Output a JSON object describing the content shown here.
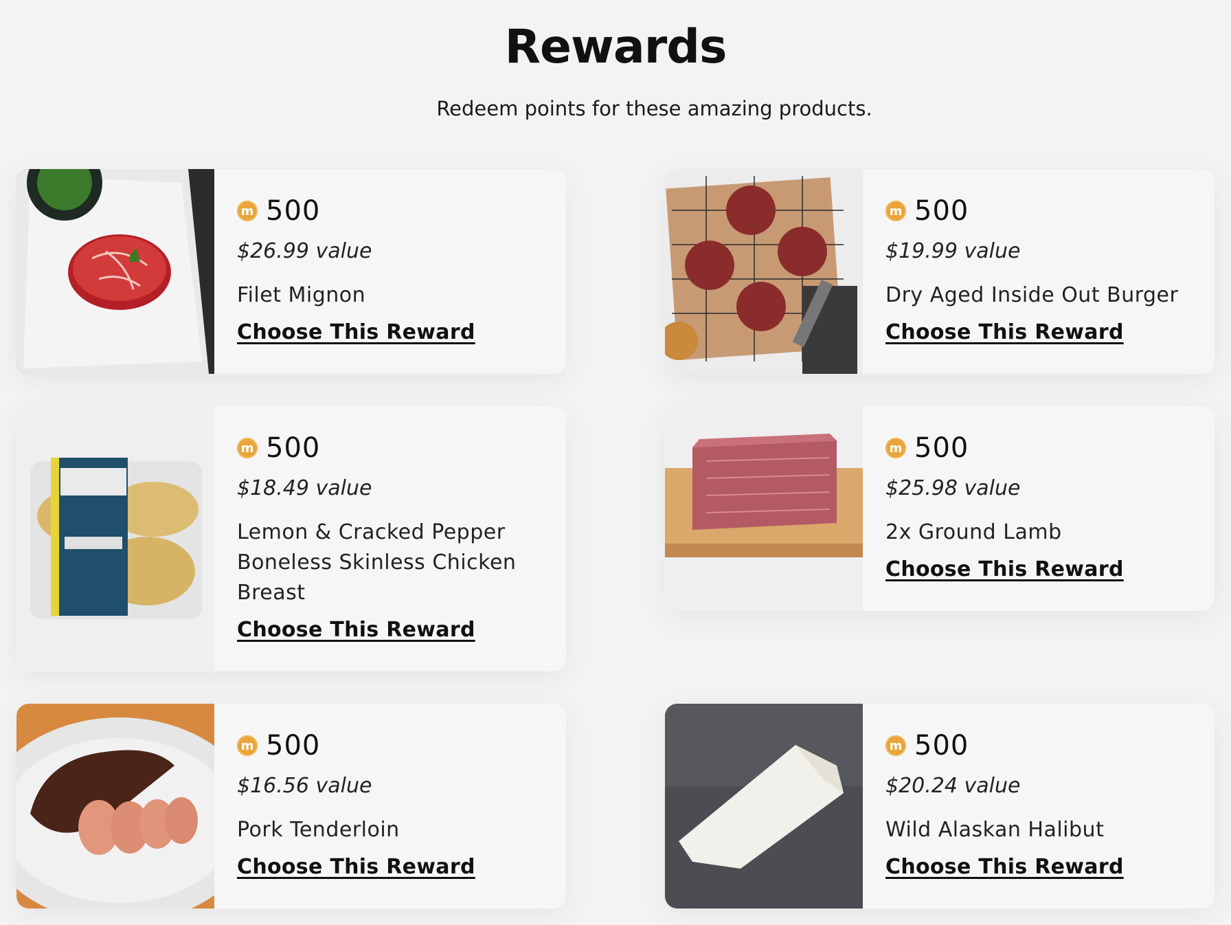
{
  "header": {
    "title": "Rewards",
    "subtitle": "Redeem points for these amazing products."
  },
  "coin_icon": "coin-icon",
  "coin_letter": "m",
  "accent_color": "#e9a53a",
  "rewards": [
    {
      "points": "500",
      "value": "$26.99 value",
      "name": "Filet Mignon",
      "cta": "Choose This Reward",
      "image": "filet-mignon-photo"
    },
    {
      "points": "500",
      "value": "$19.99 value",
      "name": "Dry Aged Inside Out Burger",
      "cta": "Choose This Reward",
      "image": "burger-patties-photo"
    },
    {
      "points": "500",
      "value": "$18.49 value",
      "name": "Lemon & Cracked Pepper Boneless Skinless Chicken Breast",
      "cta": "Choose This Reward",
      "image": "chicken-breast-package-photo"
    },
    {
      "points": "500",
      "value": "$25.98 value",
      "name": "2x Ground Lamb",
      "cta": "Choose This Reward",
      "image": "ground-lamb-photo"
    },
    {
      "points": "500",
      "value": "$16.56 value",
      "name": "Pork Tenderloin",
      "cta": "Choose This Reward",
      "image": "pork-tenderloin-photo"
    },
    {
      "points": "500",
      "value": "$20.24 value",
      "name": "Wild Alaskan Halibut",
      "cta": "Choose This Reward",
      "image": "halibut-photo"
    }
  ]
}
